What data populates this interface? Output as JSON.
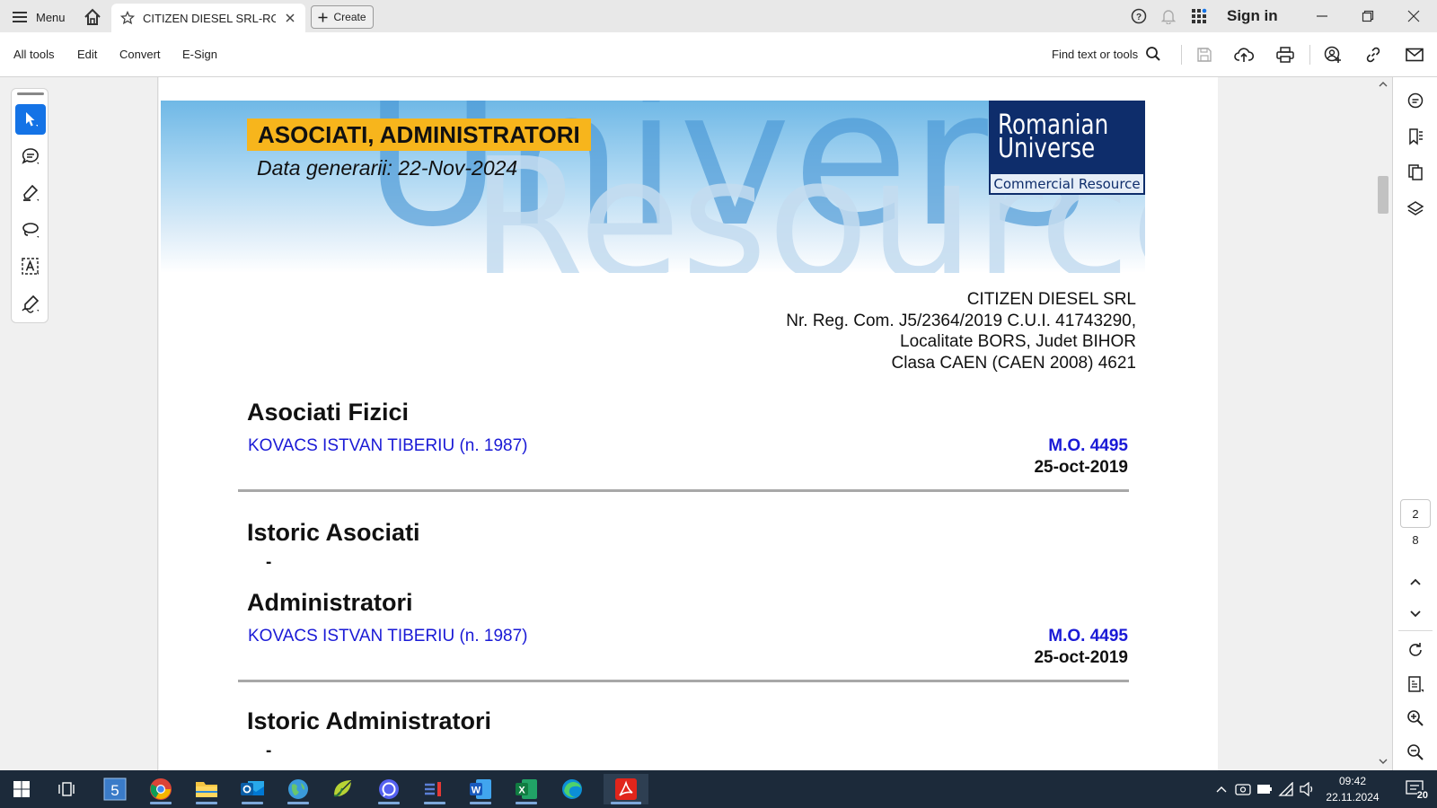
{
  "titlebar": {
    "menu_label": "Menu",
    "tab_title": "CITIZEN DIESEL SRL-RO...",
    "create_label": "Create",
    "sign_in_label": "Sign in"
  },
  "toolbar": {
    "menu_items": [
      "All tools",
      "Edit",
      "Convert",
      "E-Sign"
    ],
    "find_label": "Find text or tools"
  },
  "document": {
    "banner_title": "ASOCIATI, ADMINISTRATORI",
    "banner_date": "Data generarii: 22-Nov-2024",
    "watermark_top": "Univers",
    "watermark_bottom": "Resource",
    "logo_line1": "Romanian",
    "logo_line2": "Universe",
    "logo_sub": "Commercial Resource",
    "company": [
      "CITIZEN DIESEL SRL",
      "Nr. Reg. Com. J5/2364/2019 C.U.I. 41743290,",
      "Localitate BORS, Judet BIHOR",
      "Clasa CAEN (CAEN 2008) 4621"
    ],
    "sections": {
      "asociati_fizici": {
        "heading": "Asociati Fizici",
        "person": "KOVACS ISTVAN TIBERIU (n. 1987)",
        "mo": "M.O. 4495",
        "date": "25-oct-2019"
      },
      "istoric_asociati": {
        "heading": "Istoric Asociati",
        "value": "-"
      },
      "administratori": {
        "heading": "Administratori",
        "person": "KOVACS ISTVAN TIBERIU (n. 1987)",
        "mo": "M.O. 4495",
        "date": "25-oct-2019"
      },
      "istoric_administratori": {
        "heading": "Istoric Administratori",
        "value": "-"
      }
    }
  },
  "right_rail": {
    "current_page": "2",
    "total_pages": "8"
  },
  "taskbar": {
    "time": "09:42",
    "date": "22.11.2024",
    "notification_count": "20"
  },
  "colors": {
    "accent": "#1473e6",
    "banner_title_bg": "#f7b51c",
    "link_blue": "#1a1ad6",
    "logo_navy": "#0e2d6b",
    "taskbar": "#1c2a3a"
  }
}
